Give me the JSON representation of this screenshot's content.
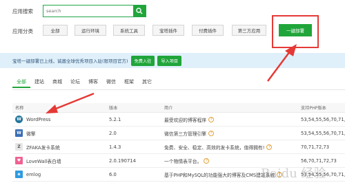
{
  "search": {
    "label": "应用搜索",
    "placeholder": "search"
  },
  "categories": {
    "label": "应用分类",
    "items": [
      "全部",
      "运行环境",
      "系统工具",
      "宝塔插件",
      "付费插件",
      "第三方应用",
      "一键部署"
    ],
    "active": "一键部署"
  },
  "notice": {
    "text": "宝塔一键部署已上线，诚邀全球优秀项目入驻(限项目官方)",
    "btn_apply": "免费入驻",
    "btn_import": "导入项目"
  },
  "tabs": [
    "全部",
    "建站",
    "商城",
    "论坛",
    "博客",
    "微信",
    "框架",
    "其它"
  ],
  "table": {
    "headers": {
      "name": "名称",
      "version": "版本",
      "desc": "简介",
      "php": "支持PHP版本"
    },
    "rows": [
      {
        "name": "WordPress",
        "icon": "wordpress-icon",
        "version": "5.2.1",
        "desc": "最受欢迎的博客程序",
        "php": "53,54,55,56,70,71,72"
      },
      {
        "name": "微擎",
        "icon": "weengine-icon",
        "version": "2.0",
        "desc": "微信第三方管理引擎",
        "php": "53,54,55,56,70,71,72"
      },
      {
        "name": "ZFAKA发卡系统",
        "icon": "zfaka-icon",
        "version": "1.4.3",
        "desc": "免费、安全、稳定、高效的发卡系统，值得拥有!",
        "php": "70,71,72,73"
      },
      {
        "name": "LoveWall表白墙",
        "icon": "lovewall-icon",
        "version": "2.0.190714",
        "desc": "一个物情表平台。",
        "php": "56,70,71,72,73"
      },
      {
        "name": "emlog",
        "icon": "emlog-icon",
        "version": "6.0",
        "desc": "基于PHP和MySQL的功能强大的博客及CMS建站系统",
        "php": "53,54,55,56,70,71,72"
      }
    ]
  },
  "watermark": "Baidu 经验",
  "colors": {
    "accent": "#20a53a",
    "annotation": "#e53935",
    "notice_bg": "#dff0fb"
  }
}
